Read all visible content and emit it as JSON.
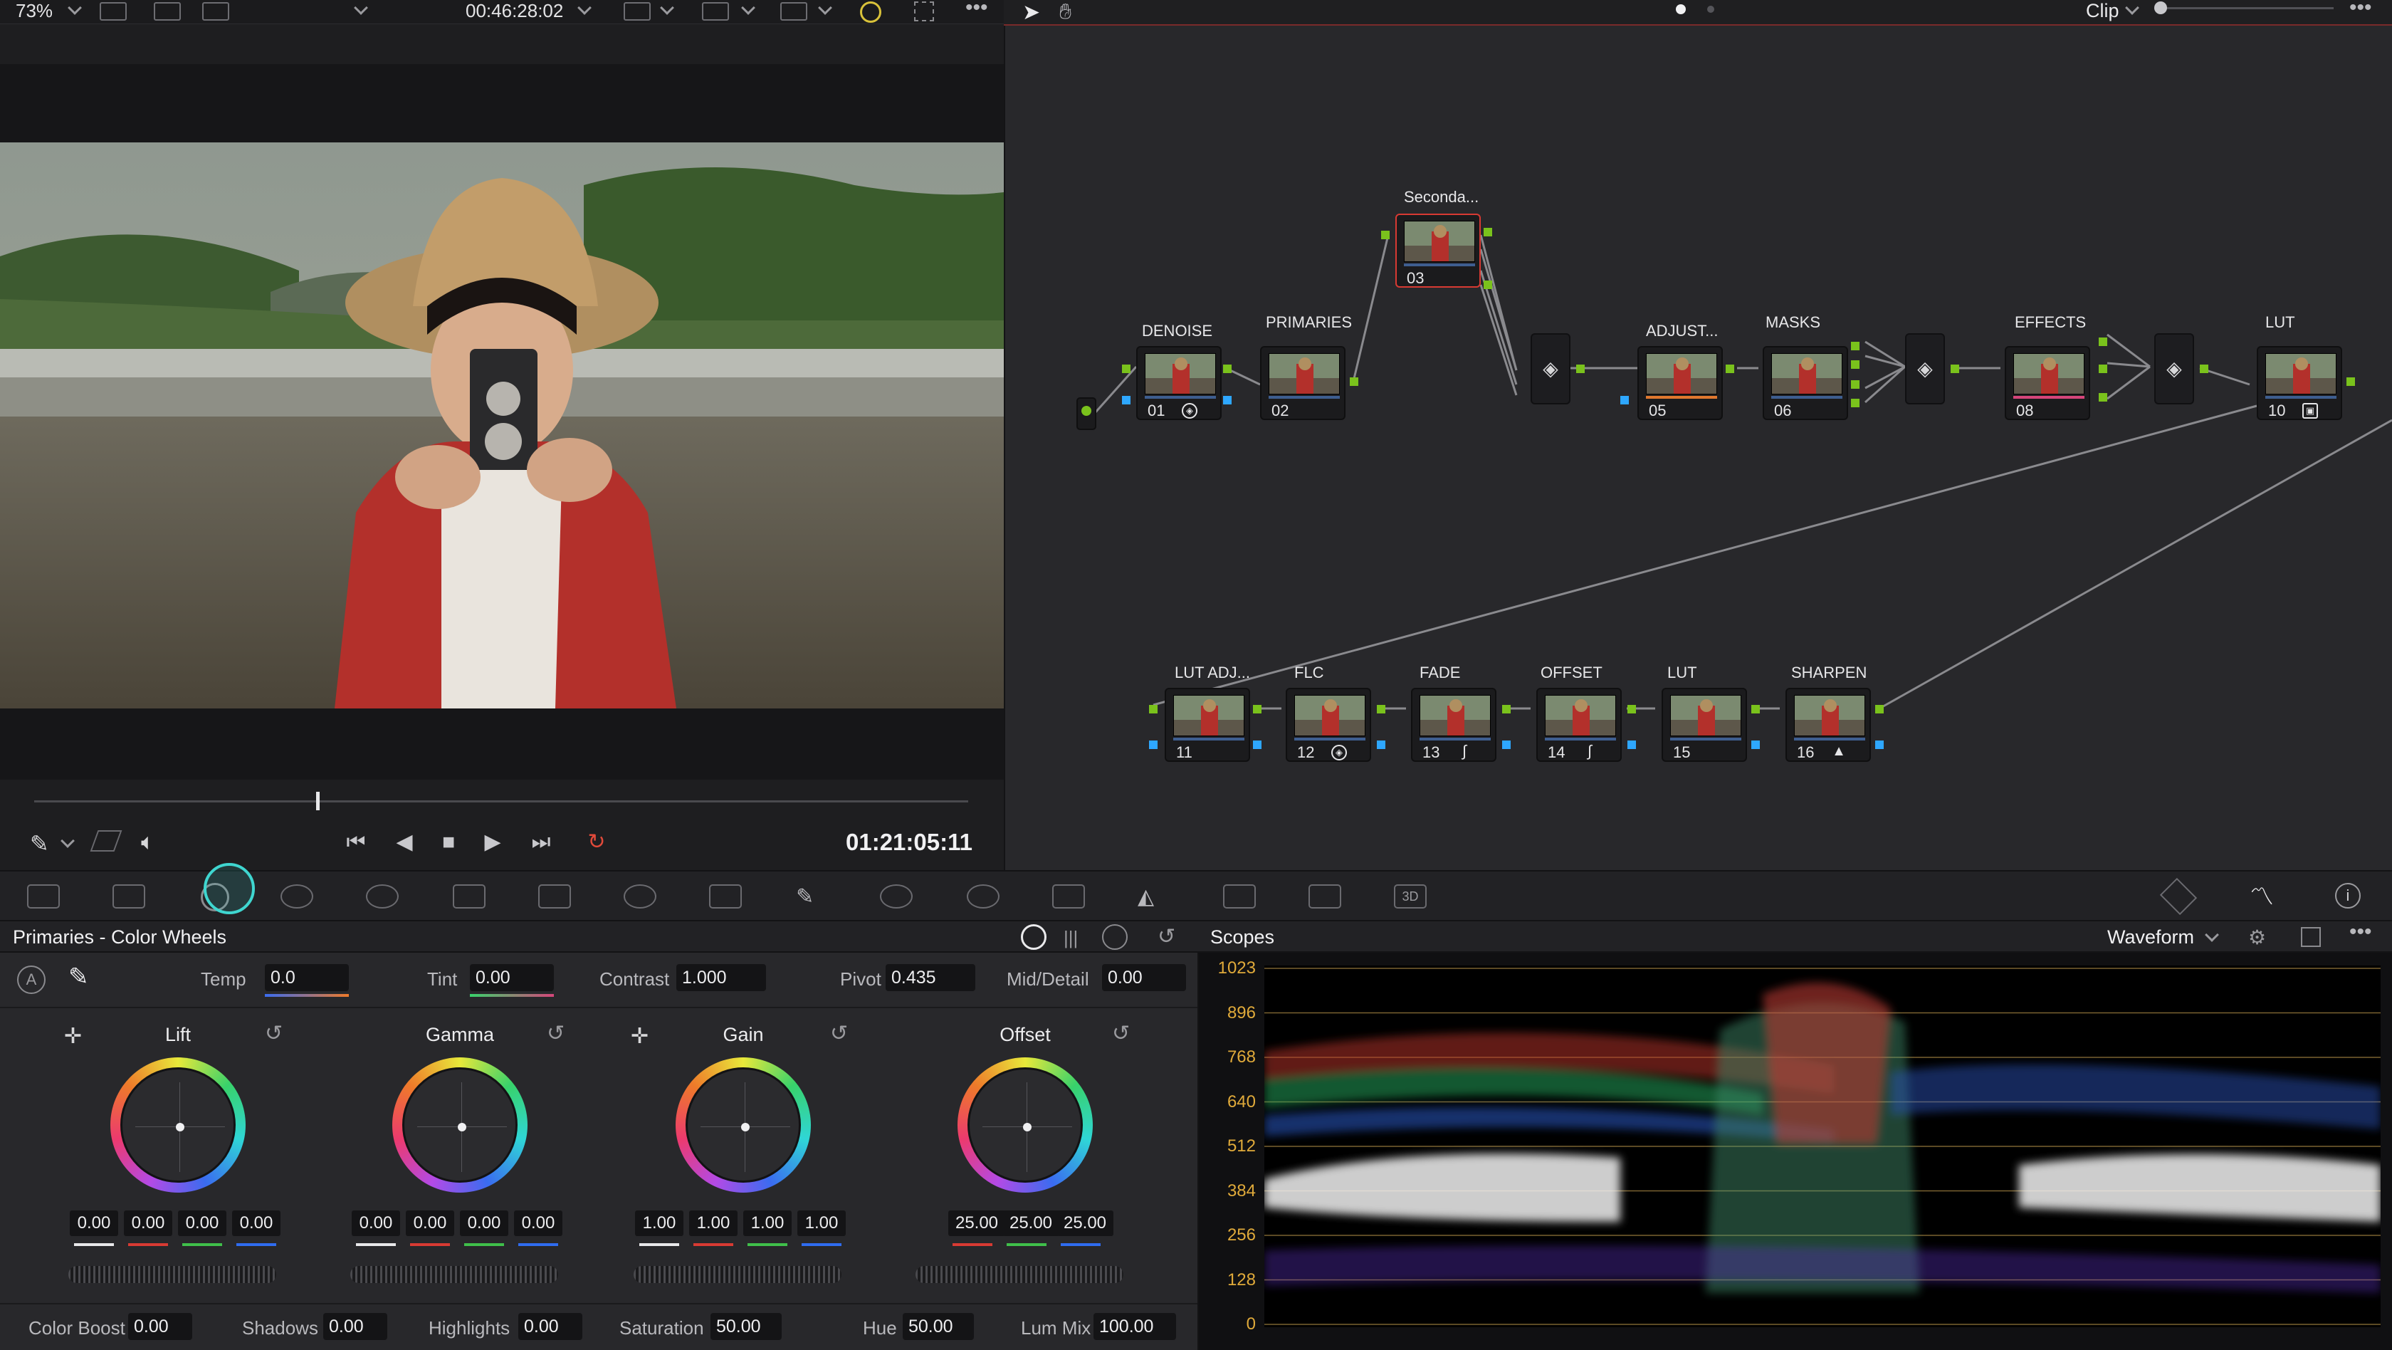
{
  "viewer": {
    "zoom": "73%",
    "timecode_top": "00:46:28:02",
    "timecode_bottom": "01:21:05:11"
  },
  "node_editor": {
    "mode": "Clip",
    "nodes_top": [
      {
        "label": "DENOISE",
        "num": "01",
        "badge": "noise-reduction-icon"
      },
      {
        "label": "PRIMARIES",
        "num": "02"
      },
      {
        "label": "Seconda...",
        "num": "03"
      },
      {
        "label": "ADJUST...",
        "num": "05"
      },
      {
        "label": "MASKS",
        "num": "06"
      },
      {
        "label": "EFFECTS",
        "num": "08"
      },
      {
        "label": "LUT",
        "num": "10"
      }
    ],
    "nodes_bottom": [
      {
        "label": "LUT ADJ...",
        "num": "11"
      },
      {
        "label": "FLC",
        "num": "12"
      },
      {
        "label": "FADE",
        "num": "13"
      },
      {
        "label": "OFFSET",
        "num": "14"
      },
      {
        "label": "LUT",
        "num": "15"
      },
      {
        "label": "SHARPEN",
        "num": "16"
      }
    ]
  },
  "primaries": {
    "title": "Primaries - Color Wheels",
    "top_params": [
      {
        "label": "Temp",
        "value": "0.0"
      },
      {
        "label": "Tint",
        "value": "0.00"
      },
      {
        "label": "Contrast",
        "value": "1.000"
      },
      {
        "label": "Pivot",
        "value": "0.435"
      },
      {
        "label": "Mid/Detail",
        "value": "0.00"
      }
    ],
    "wheels": [
      {
        "name": "Lift",
        "values": [
          "0.00",
          "0.00",
          "0.00",
          "0.00"
        ]
      },
      {
        "name": "Gamma",
        "values": [
          "0.00",
          "0.00",
          "0.00",
          "0.00"
        ]
      },
      {
        "name": "Gain",
        "values": [
          "1.00",
          "1.00",
          "1.00",
          "1.00"
        ]
      },
      {
        "name": "Offset",
        "values": [
          "25.00",
          "25.00",
          "25.00"
        ]
      }
    ],
    "bottom_params": [
      {
        "label": "Color Boost",
        "value": "0.00"
      },
      {
        "label": "Shadows",
        "value": "0.00"
      },
      {
        "label": "Highlights",
        "value": "0.00"
      },
      {
        "label": "Saturation",
        "value": "50.00"
      },
      {
        "label": "Hue",
        "value": "50.00"
      },
      {
        "label": "Lum Mix",
        "value": "100.00"
      }
    ]
  },
  "scopes": {
    "title": "Scopes",
    "mode": "Waveform",
    "axis": [
      "1023",
      "896",
      "768",
      "640",
      "512",
      "384",
      "256",
      "128",
      "0"
    ]
  },
  "colors": {
    "accent_red": "#d83a33",
    "node_green": "#7ac21c",
    "node_blue": "#2ea7ff",
    "axis_amber": "#e0aa3a"
  }
}
